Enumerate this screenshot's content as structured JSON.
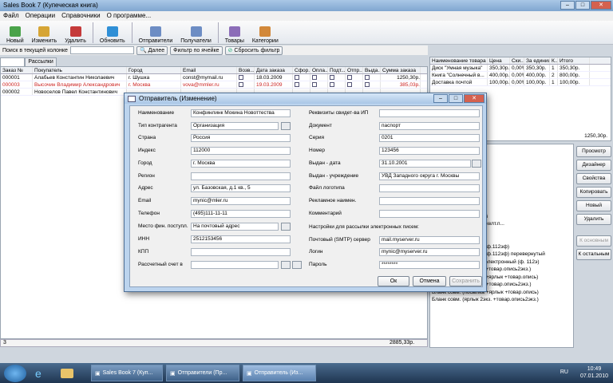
{
  "app": {
    "title": "Sales Book 7 (Купеческая книга)"
  },
  "menu": [
    "Файл",
    "Операции",
    "Справочники",
    "О программе..."
  ],
  "toolbar": [
    "Новый",
    "Изменить",
    "Удалить",
    "Обновить",
    "Отправители",
    "Получатели",
    "Товары",
    "Категории"
  ],
  "toolbar_colors": [
    "#4aa34a",
    "#d6a535",
    "#c53a3a",
    "#2f8fd6",
    "#6d8dc4",
    "#6d8dc4",
    "#8c6db8",
    "#d2883a"
  ],
  "search": {
    "label": "Поиск в текущей колонке",
    "next": "Далее",
    "filter_cell": "Фильтр по ячейке",
    "reset": "Сбросить фильтр"
  },
  "tabs": [
    "Заказы",
    "Рассылки"
  ],
  "orders": {
    "headers": [
      "Заказ №",
      "Покупатель",
      "Город",
      "Email",
      "Возв...",
      "Дата заказа",
      "Сфор...",
      "Опла...",
      "Подт...",
      "Отпр...",
      "Выда...",
      "Сумма заказа"
    ],
    "rows": [
      [
        "000001",
        "Алабьев Константин Николаевич",
        "г. Шушка",
        "const@mymail.ru",
        "",
        "18.03.2009",
        "",
        "",
        "",
        "",
        "",
        "1250,30р."
      ],
      [
        "000003",
        "Высочин Владимир Александрович",
        "г. Москва",
        "vova@mmler.ru",
        "",
        "19.03.2009",
        "",
        "",
        "",
        "",
        "",
        "385,03р."
      ],
      [
        "000002",
        "Новоселов Павел Константинович",
        "",
        "",
        "",
        "",
        "",
        "",
        "",
        "",
        "",
        ""
      ]
    ],
    "footer_count": "3",
    "footer_sum": "2885,33р."
  },
  "goods": {
    "headers": [
      "Наименование товара",
      "Цена",
      "Ски...",
      "За единицу",
      "К...",
      "Итого"
    ],
    "rows": [
      [
        "Диск \"Умная музыка\"",
        "350,30р.",
        "0,00%",
        "350,30р.",
        "1",
        "350,30р."
      ],
      [
        "Книга \"Солнечный в...",
        "400,00р.",
        "0,00%",
        "400,00р.",
        "2",
        "800,00р."
      ],
      [
        "Доставка почтой",
        "100,00р.",
        "0,00%",
        "100,00р.",
        "1",
        "100,00р."
      ]
    ],
    "total": "1250,30р."
  },
  "forms": [
    "...ая декларация)",
    "...13ан)",
    "...117+ф.113, старый)",
    "...категория 2 экз.)",
    "...товарам 2 экз.)",
    "",
    "",
    "",
    "...сопроводительная)",
    "...113ан) перевернутый",
    "...117+ф.113, старый) желт.п...",
    "...категория 2 экз.)",
    "...товарам 2 экз.)",
    "Бланк почт. перевода (ф.112эф)",
    "Бланк почт. перевода (ф.112эф) перевернутый",
    "Бланк почт. перевода электронный (ф. 112э)",
    "Бланк совм. (перевод +товар.опись2экз.)",
    "Бланк совм. (перевод +ярлык +товар.опись)",
    "Бланк совм. (посылка +товар.опись2экз.)",
    "Бланк совм. (посылка +ярлык +товар.опись)",
    "Бланк совм. (ярлык 2экз. +товар.опись2экз.)"
  ],
  "side_buttons": [
    "Просмотр",
    "Дизайнер",
    "Свойства",
    "Копировать",
    "Новый",
    "Удалить",
    "К основным",
    "К остальным"
  ],
  "dialog": {
    "title": "Отправитель (Изменение)",
    "left_labels": [
      "Наименование",
      "Тип контрагента",
      "Страна",
      "Индекс",
      "Город",
      "Регион",
      "Адрес",
      "Email",
      "Телефон",
      "Место фин. поступл.",
      "ИНН",
      "КПП",
      "Рассчетный счет в"
    ],
    "left_values": [
      "Конфинлинк Мокина Новоттества",
      "Организация",
      "Россия",
      "112000",
      "г. Москва",
      "",
      "ул. Базовская, д.1 кв., 5",
      "mynic@mler.ru",
      "(495)111-11-11",
      "На почтовый адрес",
      "2512153456",
      "",
      ""
    ],
    "right_labels": [
      "Реквизиты свидет-ва ИП",
      "Документ",
      "Серия",
      "Номер",
      "Выдан - дата",
      "Выдан - учреждение",
      "Файл логотипа",
      "Рекламное наимен.",
      "Комментарий"
    ],
    "right_values": [
      "",
      "паспорт",
      "0201",
      "123456",
      "31.10.2001",
      "УВД Западного округа г. Москвы",
      "",
      "",
      ""
    ],
    "mail_header": "Настройки для рассылки электронных писем:",
    "mail_labels": [
      "Почтовый (SMTP) сервер",
      "Логин",
      "Пароль"
    ],
    "mail_values": [
      "mail.myserver.ru",
      "mynic@myserver.ru",
      "********"
    ],
    "ok": "Ок",
    "cancel": "Отмена",
    "save": "Сохранить"
  },
  "taskbar": {
    "items": [
      "Sales Book 7 (Куп...",
      "Отправители (Пр...",
      "Отправитель (Из..."
    ],
    "lang": "RU",
    "time": "10:49",
    "date": "07.01.2010"
  }
}
